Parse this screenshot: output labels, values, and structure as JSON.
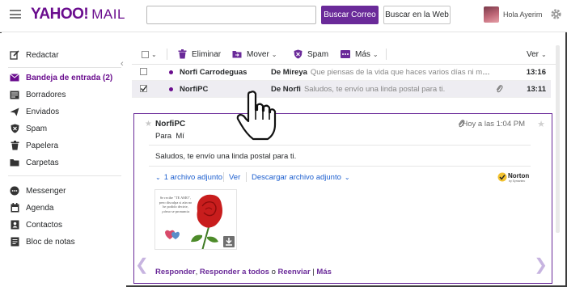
{
  "header": {
    "logo": "YAHOO!",
    "logo_mail": "MAIL",
    "search_value": "",
    "search_mail_button": "Buscar Correo",
    "search_web_button": "Buscar en la Web",
    "greeting": "Hola Ayerim"
  },
  "sidebar": {
    "compose": "Redactar",
    "folders": [
      {
        "label": "Bandeja de entrada (2)",
        "icon": "envelope-icon"
      },
      {
        "label": "Borradores",
        "icon": "drafts-icon"
      },
      {
        "label": "Enviados",
        "icon": "sent-icon"
      },
      {
        "label": "Spam",
        "icon": "shield-icon"
      },
      {
        "label": "Papelera",
        "icon": "trash-icon"
      },
      {
        "label": "Carpetas",
        "icon": "folder-icon"
      }
    ],
    "apps": [
      {
        "label": "Messenger",
        "icon": "chat-icon"
      },
      {
        "label": "Agenda",
        "icon": "calendar-icon"
      },
      {
        "label": "Contactos",
        "icon": "contacts-icon"
      },
      {
        "label": "Bloc de notas",
        "icon": "notepad-icon"
      }
    ]
  },
  "toolbar": {
    "delete": "Eliminar",
    "move": "Mover",
    "spam": "Spam",
    "more": "Más",
    "view": "Ver"
  },
  "messages": [
    {
      "from": "Norfi Carrodeguas",
      "subject": "De Mireya",
      "snippet": "Que piensas de la vida que haces varios días ni me lla",
      "time": "13:16",
      "checked": false,
      "attachment": false
    },
    {
      "from": "NorfiPC",
      "subject": "De Norfi",
      "snippet": "Saludos, te envío una linda postal para ti.",
      "time": "13:11",
      "checked": true,
      "attachment": true
    }
  ],
  "preview": {
    "from": "NorfiPC",
    "to_label": "Para",
    "to": "Mí",
    "time": "Hoy a las 1:04 PM",
    "body": "Saludos, te envío una linda postal para ti.",
    "attachments_count": "1 archivo adjunto",
    "view": "Ver",
    "download": "Descargar archivo adjunto",
    "norton": "Norton",
    "norton_sub": "by Symantec",
    "thumbnail_text": "Se recibe \"TE AMO\", pero disculpa si aún no he podido decirte, ¡cómo se pronuncia",
    "actions": {
      "reply": "Responder",
      "reply_all": "Responder a todos",
      "or": "o",
      "forward": "Reenviar",
      "sep": "|",
      "more": "Más"
    }
  },
  "colors": {
    "brand": "#6a0d8e",
    "button": "#6a2a99",
    "link": "#1d5fcf"
  }
}
